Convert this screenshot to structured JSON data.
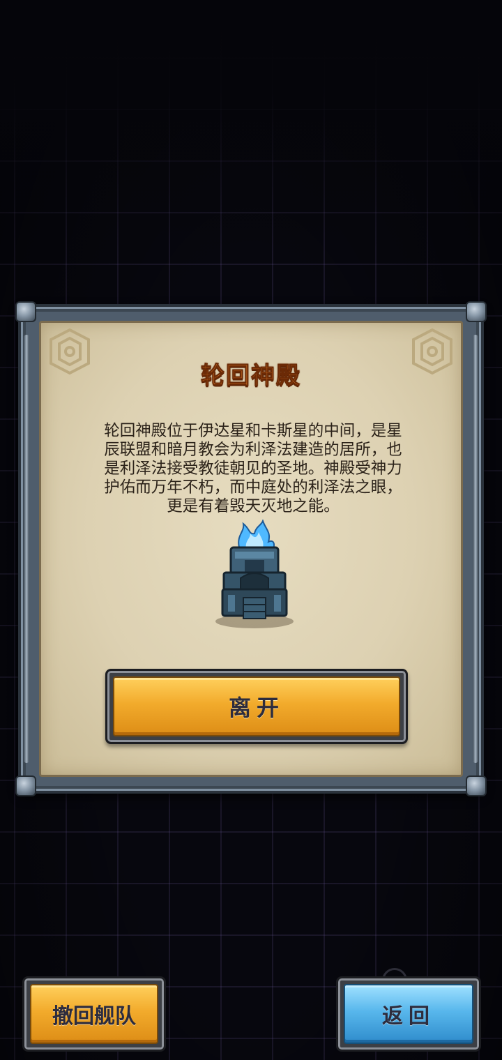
{
  "dialog": {
    "title": "轮回神殿",
    "description_lines": [
      "轮回神殿位于伊达星和卡斯星的中间，是星",
      "辰联盟和暗月教会为利泽法建造的居所，也",
      "是利泽法接受教徒朝见的圣地。神殿受神力",
      "护佑而万年不朽，而中庭处的利泽法之眼，",
      "更是有着毁天灭地之能。"
    ],
    "image_icon": "temple-icon",
    "leave_label": "离开"
  },
  "buttons": {
    "recall_label": "撤回舰队",
    "return_label": "返回"
  },
  "colors": {
    "title": "#e07d2a",
    "orange_button": "#f2ab2c",
    "blue_button": "#58b7ec",
    "parchment": "#ddd1b2",
    "frame": "#4f5d6c"
  }
}
